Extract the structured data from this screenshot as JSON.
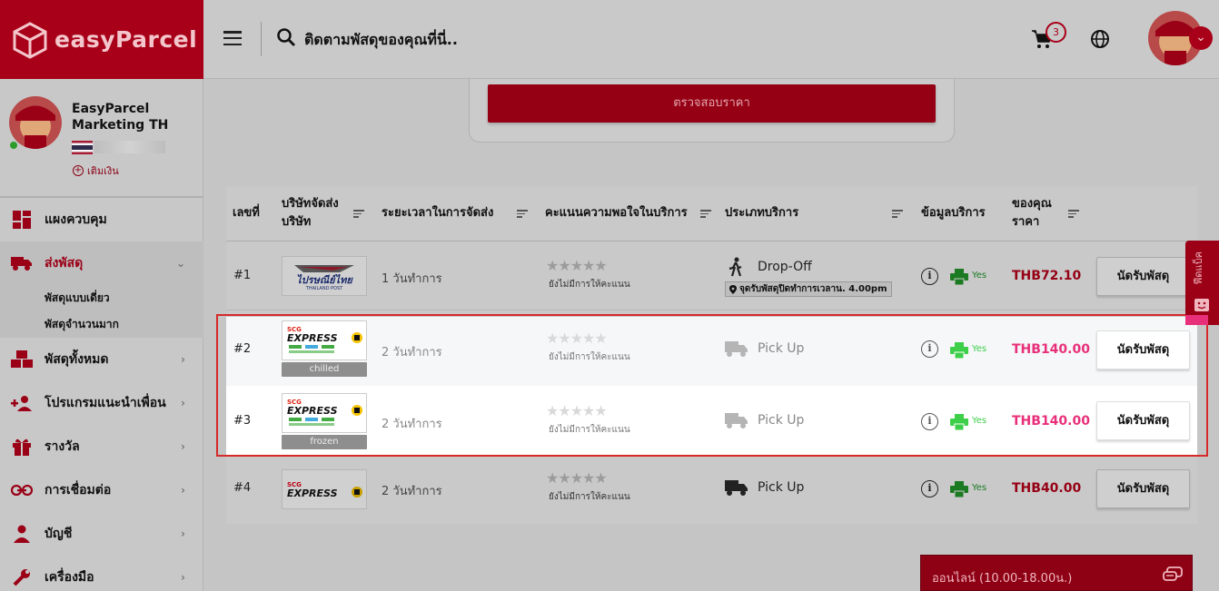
{
  "brand": {
    "logo_text": "easyParcel"
  },
  "header": {
    "search_placeholder": "ติดตามพัสดุของคุณที่นี่..",
    "cart_count": "3"
  },
  "profile": {
    "name": "EasyParcel Marketing TH",
    "topup_label": "เติมเงิน"
  },
  "sidebar": {
    "items": [
      {
        "label": "แผงควบคุม",
        "icon": "dashboard-icon"
      },
      {
        "label": "ส่งพัสดุ",
        "icon": "truck-icon",
        "active": true
      },
      {
        "label": "พัสดุทั้งหมด",
        "icon": "boxes-icon"
      },
      {
        "label": "โปรแกรมแนะนำเพื่อน",
        "icon": "add-user-icon"
      },
      {
        "label": "รางวัล",
        "icon": "gift-icon"
      },
      {
        "label": "การเชื่อมต่อ",
        "icon": "link-icon"
      },
      {
        "label": "บัญชี",
        "icon": "person-icon"
      },
      {
        "label": "เครื่องมือ",
        "icon": "wrench-icon"
      }
    ],
    "subitems": [
      "พัสดุแบบเดี่ยว",
      "พัสดุจำนวนมาก"
    ]
  },
  "check_price_button": "ตรวจสอบราคา",
  "table": {
    "headers": {
      "no": "เลขที่",
      "carrier": "บริษัทจัดส่งบริษัท",
      "carrier_line1": "บริษัทจัดส่ง",
      "carrier_line2": "บริษัท",
      "duration": "ระยะเวลาในการจัดส่ง",
      "rating": "คะแนนความพอใจในบริการ",
      "service_type": "ประเภทบริการ",
      "service_info": "ข้อมูลบริการ",
      "price_line1": "ของคุณ",
      "price_line2": "ราคา"
    },
    "rows": [
      {
        "no": "#1",
        "carrier": "ไปรษณีย์ไทย THAILAND POST",
        "tag": "",
        "duration": "1 วันทำการ",
        "rating_text": "ยังไม่มีการให้คะแนน",
        "service": "Drop-Off",
        "note": "จุดรับพัสดุปิดทำการเวลาน. 4.00pm",
        "print": "Yes",
        "price": "THB72.10",
        "button": "นัดรับพัสดุ"
      },
      {
        "no": "#2",
        "carrier": "SCG EXPRESS",
        "tag": "chilled",
        "duration": "2 วันทำการ",
        "rating_text": "ยังไม่มีการให้คะแนน",
        "service": "Pick Up",
        "print": "Yes",
        "price": "THB140.00",
        "button": "นัดรับพัสดุ"
      },
      {
        "no": "#3",
        "carrier": "SCG EXPRESS",
        "tag": "frozen",
        "duration": "2 วันทำการ",
        "rating_text": "ยังไม่มีการให้คะแนน",
        "service": "Pick Up",
        "print": "Yes",
        "price": "THB140.00",
        "button": "นัดรับพัสดุ"
      },
      {
        "no": "#4",
        "carrier": "SCG EXPRESS",
        "tag": "",
        "duration": "2 วันทำการ",
        "rating_text": "ยังไม่มีการให้คะแนน",
        "service": "Pick Up",
        "print": "Yes",
        "price": "THB40.00",
        "button": "นัดรับพัสดุ"
      }
    ]
  },
  "feedback_label": "ฟีดแบ็ค",
  "online_label": "ออนไลน์ (10.00-18.00น.)",
  "colors": {
    "brand": "#a80018",
    "price_highlight": "#e8307a",
    "print_yes": "#3ecf4a"
  }
}
